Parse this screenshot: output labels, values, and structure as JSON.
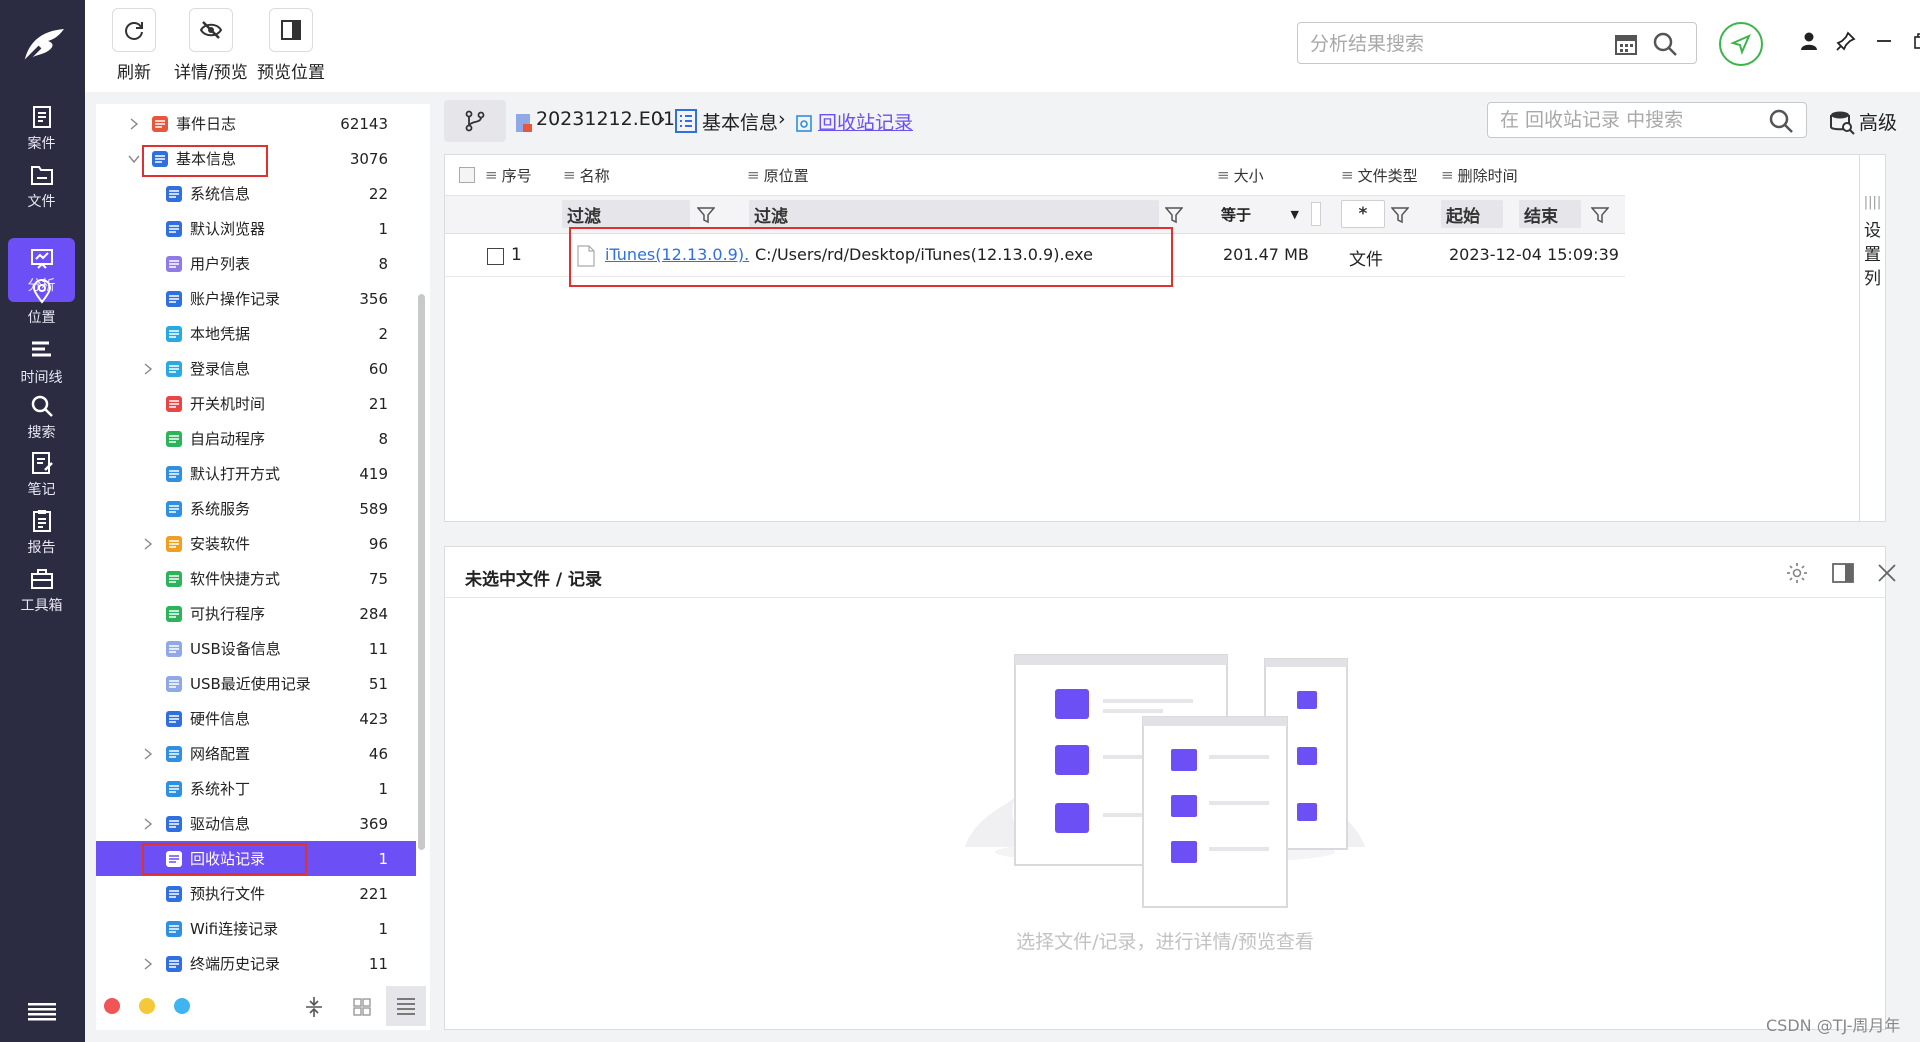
{
  "rail": {
    "items": [
      {
        "label": "案件",
        "icon": "case-icon"
      },
      {
        "label": "文件",
        "icon": "folder-icon"
      },
      {
        "label": "分析",
        "icon": "analysis-icon"
      },
      {
        "label": "位置",
        "icon": "location-icon"
      },
      {
        "label": "时间线",
        "icon": "timeline-icon"
      },
      {
        "label": "搜索",
        "icon": "search-icon"
      },
      {
        "label": "笔记",
        "icon": "note-icon"
      },
      {
        "label": "报告",
        "icon": "report-icon"
      },
      {
        "label": "工具箱",
        "icon": "toolbox-icon"
      }
    ],
    "active_index": 2
  },
  "toolbar": {
    "refresh": "刷新",
    "detail_preview": "详情/预览",
    "preview_position": "预览位置",
    "search_placeholder": "分析结果搜索"
  },
  "tree": {
    "items": [
      {
        "label": "事件日志",
        "count": "62143",
        "level": 0,
        "expand": "collapsed",
        "color": "#e8563c"
      },
      {
        "label": "基本信息",
        "count": "3076",
        "level": 0,
        "expand": "expanded",
        "color": "#2f6fe0"
      },
      {
        "label": "系统信息",
        "count": "22",
        "level": 1,
        "expand": "none",
        "color": "#2f6fe0"
      },
      {
        "label": "默认浏览器",
        "count": "1",
        "level": 1,
        "expand": "none",
        "color": "#2f6fe0"
      },
      {
        "label": "用户列表",
        "count": "8",
        "level": 1,
        "expand": "none",
        "color": "#8f7ae6"
      },
      {
        "label": "账户操作记录",
        "count": "356",
        "level": 1,
        "expand": "none",
        "color": "#2f6fe0"
      },
      {
        "label": "本地凭据",
        "count": "2",
        "level": 1,
        "expand": "none",
        "color": "#2aa8e0"
      },
      {
        "label": "登录信息",
        "count": "60",
        "level": 1,
        "expand": "collapsed",
        "color": "#2aa8e0"
      },
      {
        "label": "开关机时间",
        "count": "21",
        "level": 1,
        "expand": "none",
        "color": "#e84545"
      },
      {
        "label": "自启动程序",
        "count": "8",
        "level": 1,
        "expand": "none",
        "color": "#2cb45a"
      },
      {
        "label": "默认打开方式",
        "count": "419",
        "level": 1,
        "expand": "none",
        "color": "#2f8fe0"
      },
      {
        "label": "系统服务",
        "count": "589",
        "level": 1,
        "expand": "none",
        "color": "#2f8fe0"
      },
      {
        "label": "安装软件",
        "count": "96",
        "level": 1,
        "expand": "collapsed",
        "color": "#f0a020"
      },
      {
        "label": "软件快捷方式",
        "count": "75",
        "level": 1,
        "expand": "none",
        "color": "#2cb45a"
      },
      {
        "label": "可执行程序",
        "count": "284",
        "level": 1,
        "expand": "none",
        "color": "#2cb45a"
      },
      {
        "label": "USB设备信息",
        "count": "11",
        "level": 1,
        "expand": "none",
        "color": "#8fa8e6"
      },
      {
        "label": "USB最近使用记录",
        "count": "51",
        "level": 1,
        "expand": "none",
        "color": "#8fa8e6"
      },
      {
        "label": "硬件信息",
        "count": "423",
        "level": 1,
        "expand": "none",
        "color": "#2f6fe0"
      },
      {
        "label": "网络配置",
        "count": "46",
        "level": 1,
        "expand": "collapsed",
        "color": "#2f8fe0"
      },
      {
        "label": "系统补丁",
        "count": "1",
        "level": 1,
        "expand": "none",
        "color": "#2f8fe0"
      },
      {
        "label": "驱动信息",
        "count": "369",
        "level": 1,
        "expand": "collapsed",
        "color": "#2f6fe0"
      },
      {
        "label": "回收站记录",
        "count": "1",
        "level": 1,
        "expand": "none",
        "color": "#ffffff"
      },
      {
        "label": "预执行文件",
        "count": "221",
        "level": 1,
        "expand": "none",
        "color": "#2f6fe0"
      },
      {
        "label": "Wifi连接记录",
        "count": "1",
        "level": 1,
        "expand": "none",
        "color": "#2f8fe0"
      },
      {
        "label": "终端历史记录",
        "count": "11",
        "level": 1,
        "expand": "collapsed",
        "color": "#2f6fe0"
      }
    ],
    "selected_index": 21,
    "dots": [
      "#f05454",
      "#f5c83a",
      "#40b4f0"
    ]
  },
  "breadcrumb": {
    "evidence": "20231212.E01",
    "category": "基本信息",
    "current": "回收站记录",
    "search_placeholder": "在 回收站记录 中搜索",
    "advanced": "高级"
  },
  "grid": {
    "columns": {
      "index": "序号",
      "name": "名称",
      "location": "原位置",
      "size": "大小",
      "filetype": "文件类型",
      "deleted": "删除时间"
    },
    "filters": {
      "name": "过滤",
      "location": "过滤",
      "size_op": "等于",
      "type": "*",
      "start": "起始",
      "end": "结束"
    },
    "settings_label": [
      "设",
      "置",
      "列"
    ],
    "rows": [
      {
        "index": "1",
        "name": "iTunes(12.13.0.9).",
        "location": "C:/Users/rd/Desktop/iTunes(12.13.0.9).exe",
        "size": "201.47 MB",
        "filetype": "文件",
        "deleted": "2023-12-04 15:09:39"
      }
    ]
  },
  "detail": {
    "title": "未选中文件 / 记录",
    "hint": "选择文件/记录，进行详情/预览查看"
  },
  "watermark": "CSDN @TJ-周月年",
  "colors": {
    "accent": "#6c4ff5",
    "rail": "#2b2c42",
    "highlight": "#e03131"
  }
}
